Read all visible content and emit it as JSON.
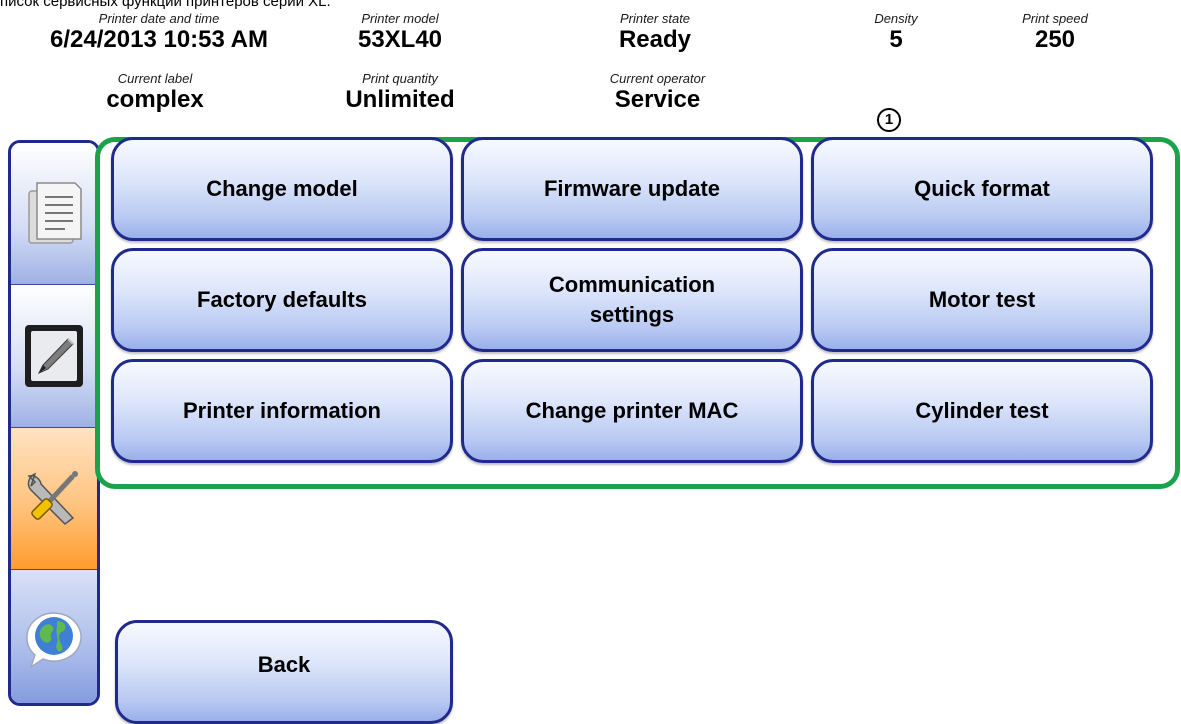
{
  "caption": "писок сервисных функций принтеров серии XL.",
  "status": {
    "printer_datetime": {
      "label": "Printer date and time",
      "value": "6/24/2013 10:53 AM"
    },
    "printer_model": {
      "label": "Printer model",
      "value": "53XL40"
    },
    "printer_state": {
      "label": "Printer state",
      "value": "Ready"
    },
    "density": {
      "label": "Density",
      "value": "5"
    },
    "print_speed": {
      "label": "Print speed",
      "value": "250"
    },
    "current_label": {
      "label": "Current label",
      "value": "complex"
    },
    "print_quantity": {
      "label": "Print quantity",
      "value": "Unlimited"
    },
    "current_operator": {
      "label": "Current operator",
      "value": "Service"
    }
  },
  "callout": "1",
  "sidebar": {
    "tabs": [
      {
        "icon": "document-list-icon",
        "selected": false
      },
      {
        "icon": "pen-editor-icon",
        "selected": false
      },
      {
        "icon": "tools-icon",
        "selected": true
      },
      {
        "icon": "globe-chat-icon",
        "selected": false
      }
    ]
  },
  "service_buttons": {
    "change_model": "Change model",
    "firmware_update": "Firmware update",
    "quick_format": "Quick format",
    "factory_defaults": "Factory defaults",
    "communication_settings_line1": "Communication",
    "communication_settings_line2": "settings",
    "motor_test": "Motor test",
    "printer_information": "Printer information",
    "change_printer_mac": "Change printer MAC",
    "cylinder_test": "Cylinder test"
  },
  "back_label": "Back",
  "colors": {
    "button_border": "#1f2a8c",
    "highlight_frame": "#1aa34a",
    "selected_tab": "#ff9c2e"
  }
}
